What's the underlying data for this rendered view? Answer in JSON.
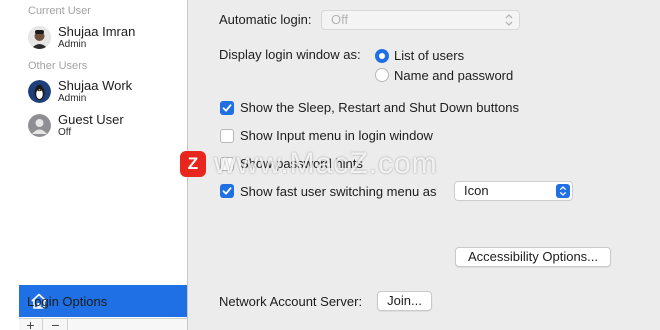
{
  "sidebar": {
    "current_users_header": "Current User",
    "other_users_header": "Other Users",
    "users": [
      {
        "name": "Shujaa Imran",
        "role": "Admin"
      },
      {
        "name": "Shujaa Work",
        "role": "Admin"
      },
      {
        "name": "Guest User",
        "role": "Off"
      }
    ],
    "login_options_label": "Login Options",
    "add_label": "+",
    "remove_label": "−"
  },
  "main": {
    "automatic_login_label": "Automatic login:",
    "automatic_login_value": "Off",
    "display_login_label": "Display login window as:",
    "radio_list_of_users": "List of users",
    "radio_name_and_password": "Name and password",
    "cb_sleep_restart": "Show the Sleep, Restart and Shut Down buttons",
    "cb_input_menu": "Show Input menu in login window",
    "cb_password_hints": "Show password hints",
    "cb_fast_user_switching": "Show fast user switching menu as",
    "fast_user_switching_value": "Icon",
    "accessibility_button": "Accessibility Options...",
    "network_account_label": "Network Account Server:",
    "join_button": "Join..."
  },
  "state": {
    "list_of_users_selected": true,
    "sleep_restart_checked": true,
    "input_menu_checked": false,
    "password_hints_checked": false,
    "fast_user_switching_checked": true
  },
  "colors": {
    "accent": "#1f6fe5",
    "watermark_logo": "#e8261e"
  },
  "watermark": {
    "logo_letter": "Z",
    "text": "www.MacZ.com"
  }
}
